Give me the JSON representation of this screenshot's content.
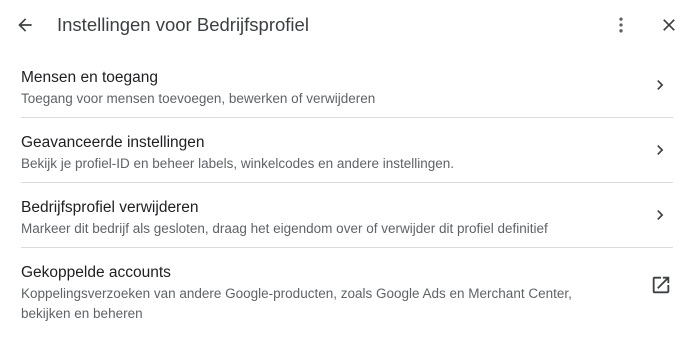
{
  "header": {
    "title": "Instellingen voor Bedrijfsprofiel",
    "back_icon": "arrow-back-icon",
    "more_icon": "more-vertical-icon",
    "close_icon": "close-icon"
  },
  "items": [
    {
      "title": "Mensen en toegang",
      "description": "Toegang voor mensen toevoegen, bewerken of verwijderen",
      "trailing_icon": "chevron-right-icon"
    },
    {
      "title": "Geavanceerde instellingen",
      "description": "Bekijk je profiel-ID en beheer labels, winkelcodes en andere instellingen.",
      "trailing_icon": "chevron-right-icon"
    },
    {
      "title": "Bedrijfsprofiel verwijderen",
      "description": "Markeer dit bedrijf als gesloten, draag het eigendom over of verwijder dit profiel definitief",
      "trailing_icon": "chevron-right-icon"
    },
    {
      "title": "Gekoppelde accounts",
      "description": "Koppelingsverzoeken van andere Google-producten, zoals Google Ads en Merchant Center, bekijken en beheren",
      "trailing_icon": "open-in-new-icon"
    }
  ],
  "colors": {
    "title_text": "#3c4043",
    "primary_text": "#202124",
    "secondary_text": "#5f6368",
    "divider": "#dadce0",
    "icon": "#5f6368"
  }
}
